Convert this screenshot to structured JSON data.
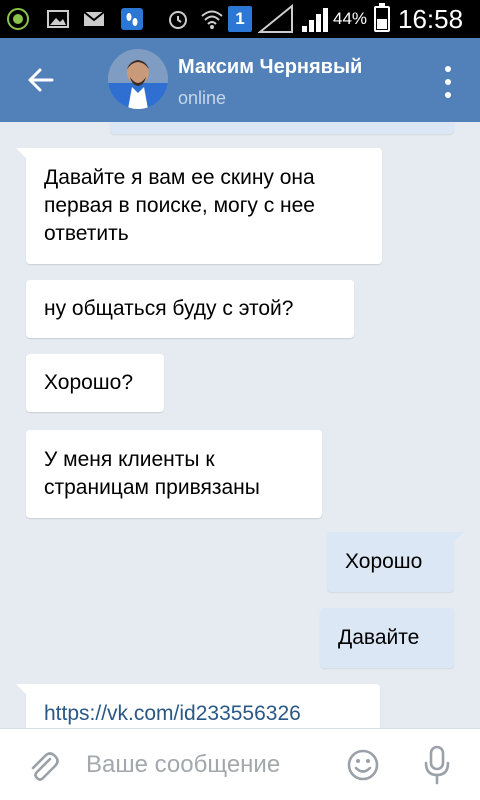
{
  "status_bar": {
    "notification_badge": "1",
    "battery_percent": "44%",
    "battery_level": 0.44,
    "time": "16:58"
  },
  "header": {
    "contact_name": "Максим Чернявый",
    "status": "online"
  },
  "messages": [
    {
      "id": 1,
      "direction": "in",
      "text": "Давайте я вам ее скину она\nпервая в поиске, могу с нее\nответить"
    },
    {
      "id": 2,
      "direction": "in",
      "text": "ну общаться буду с этой?"
    },
    {
      "id": 3,
      "direction": "in",
      "text": "Хорошо?"
    },
    {
      "id": 4,
      "direction": "in",
      "text": "У меня клиенты к\nстраницам привязаны"
    },
    {
      "id": 5,
      "direction": "out",
      "text": "Хорошо"
    },
    {
      "id": 6,
      "direction": "out",
      "text": "Давайте"
    },
    {
      "id": 7,
      "direction": "in",
      "text": "https://vk.com/id233556326"
    }
  ],
  "composer": {
    "placeholder": "Ваше сообщение",
    "value": ""
  },
  "colors": {
    "header": "#5181b8",
    "background": "#e5ebf1",
    "incoming_bubble": "#ffffff",
    "outgoing_bubble": "#dbe7f5",
    "link": "#2a5885",
    "icon_gray": "#9aa1a9"
  },
  "icons": {
    "status_bar": [
      "app-icon",
      "gallery-icon",
      "mail-icon",
      "footprints-icon",
      "alarm-icon",
      "wifi-icon",
      "signal-icon",
      "battery-icon"
    ],
    "header": [
      "back-arrow-icon",
      "more-vert-icon"
    ],
    "composer": [
      "paperclip-icon",
      "smiley-icon",
      "microphone-icon"
    ]
  }
}
